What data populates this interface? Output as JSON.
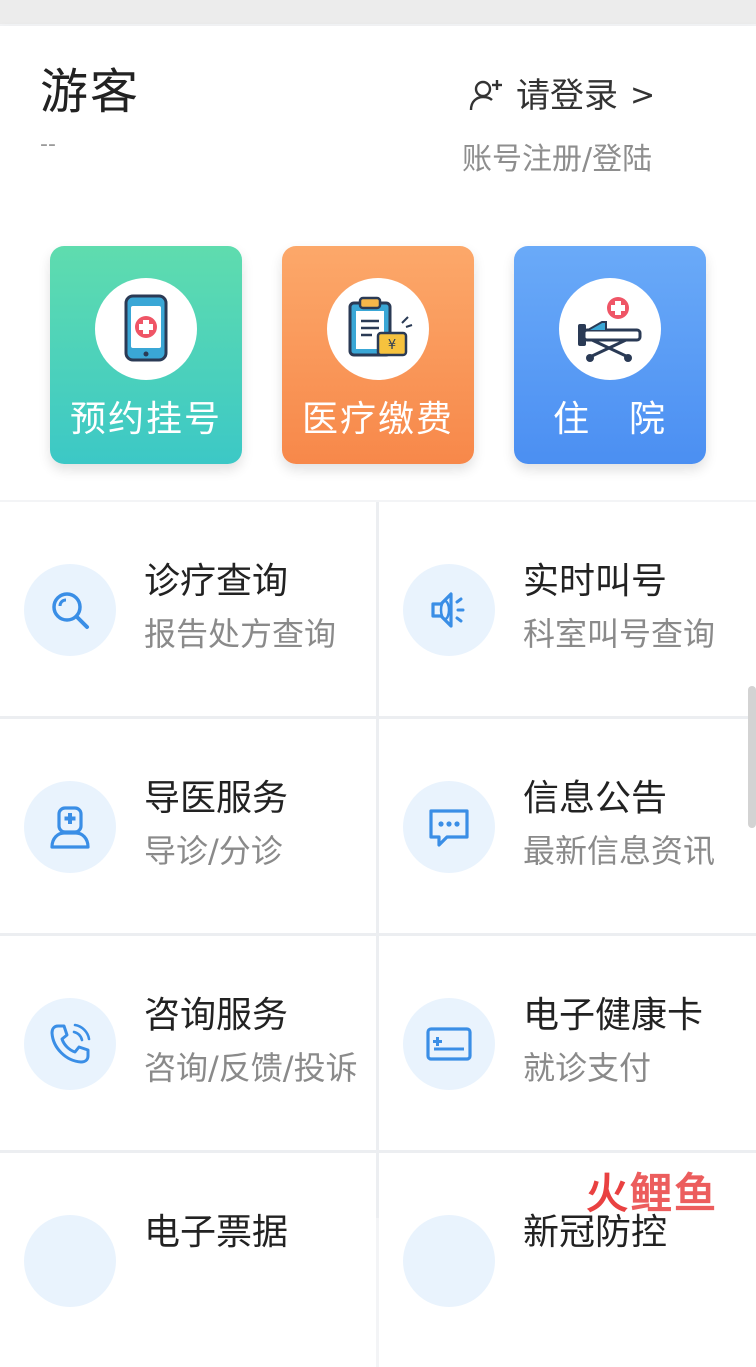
{
  "header": {
    "user_name": "游客",
    "user_sub": "--",
    "login_label": "请登录",
    "login_chevron": ">",
    "login_sub": "账号注册/登陆"
  },
  "quick_tiles": [
    {
      "label": "预约挂号",
      "icon": "phone-medical-icon",
      "color": "#3cc8c6"
    },
    {
      "label": "医疗缴费",
      "icon": "clipboard-payment-icon",
      "color": "#f7884a"
    },
    {
      "label": "住　院",
      "icon": "hospital-bed-icon",
      "color": "#4b8ff2"
    }
  ],
  "services": [
    {
      "title": "诊疗查询",
      "sub": "报告处方查询",
      "icon": "search-icon"
    },
    {
      "title": "实时叫号",
      "sub": "科室叫号查询",
      "icon": "speaker-icon"
    },
    {
      "title": "导医服务",
      "sub": "导诊/分诊",
      "icon": "doctor-icon"
    },
    {
      "title": "信息公告",
      "sub": "最新信息资讯",
      "icon": "message-icon"
    },
    {
      "title": "咨询服务",
      "sub": "咨询/反馈/投诉",
      "icon": "phone-icon"
    },
    {
      "title": "电子健康卡",
      "sub": "就诊支付",
      "icon": "card-icon"
    },
    {
      "title": "电子票据",
      "sub": "",
      "icon": "receipt-icon"
    },
    {
      "title": "新冠防控",
      "sub": "",
      "icon": "shield-icon"
    }
  ],
  "watermark": {
    "part1": "火",
    "part2": "鲤鱼"
  },
  "colors": {
    "accent": "#3a8ee6",
    "icon_bg": "#e9f3fd"
  }
}
